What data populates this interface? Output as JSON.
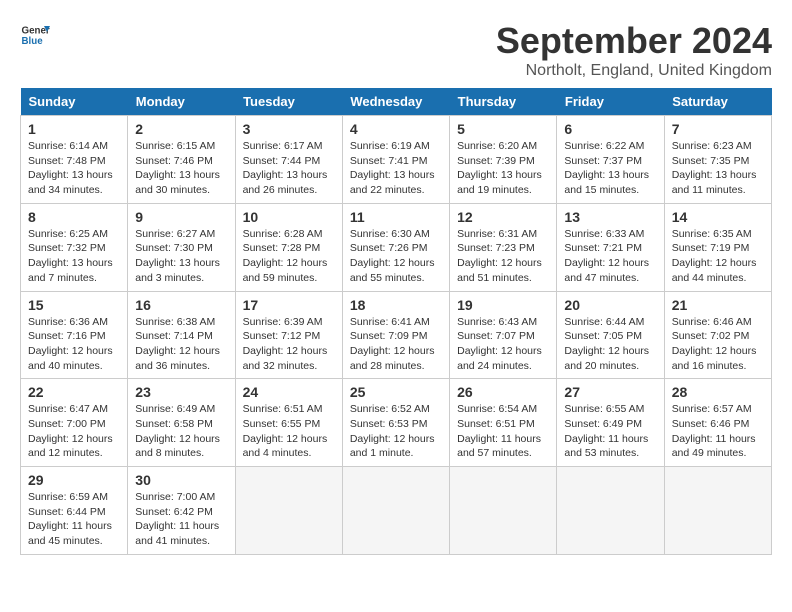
{
  "header": {
    "logo_line1": "General",
    "logo_line2": "Blue",
    "month": "September 2024",
    "location": "Northolt, England, United Kingdom"
  },
  "days_of_week": [
    "Sunday",
    "Monday",
    "Tuesday",
    "Wednesday",
    "Thursday",
    "Friday",
    "Saturday"
  ],
  "weeks": [
    [
      {
        "day": "1",
        "info": "Sunrise: 6:14 AM\nSunset: 7:48 PM\nDaylight: 13 hours\nand 34 minutes."
      },
      {
        "day": "2",
        "info": "Sunrise: 6:15 AM\nSunset: 7:46 PM\nDaylight: 13 hours\nand 30 minutes."
      },
      {
        "day": "3",
        "info": "Sunrise: 6:17 AM\nSunset: 7:44 PM\nDaylight: 13 hours\nand 26 minutes."
      },
      {
        "day": "4",
        "info": "Sunrise: 6:19 AM\nSunset: 7:41 PM\nDaylight: 13 hours\nand 22 minutes."
      },
      {
        "day": "5",
        "info": "Sunrise: 6:20 AM\nSunset: 7:39 PM\nDaylight: 13 hours\nand 19 minutes."
      },
      {
        "day": "6",
        "info": "Sunrise: 6:22 AM\nSunset: 7:37 PM\nDaylight: 13 hours\nand 15 minutes."
      },
      {
        "day": "7",
        "info": "Sunrise: 6:23 AM\nSunset: 7:35 PM\nDaylight: 13 hours\nand 11 minutes."
      }
    ],
    [
      {
        "day": "8",
        "info": "Sunrise: 6:25 AM\nSunset: 7:32 PM\nDaylight: 13 hours\nand 7 minutes."
      },
      {
        "day": "9",
        "info": "Sunrise: 6:27 AM\nSunset: 7:30 PM\nDaylight: 13 hours\nand 3 minutes."
      },
      {
        "day": "10",
        "info": "Sunrise: 6:28 AM\nSunset: 7:28 PM\nDaylight: 12 hours\nand 59 minutes."
      },
      {
        "day": "11",
        "info": "Sunrise: 6:30 AM\nSunset: 7:26 PM\nDaylight: 12 hours\nand 55 minutes."
      },
      {
        "day": "12",
        "info": "Sunrise: 6:31 AM\nSunset: 7:23 PM\nDaylight: 12 hours\nand 51 minutes."
      },
      {
        "day": "13",
        "info": "Sunrise: 6:33 AM\nSunset: 7:21 PM\nDaylight: 12 hours\nand 47 minutes."
      },
      {
        "day": "14",
        "info": "Sunrise: 6:35 AM\nSunset: 7:19 PM\nDaylight: 12 hours\nand 44 minutes."
      }
    ],
    [
      {
        "day": "15",
        "info": "Sunrise: 6:36 AM\nSunset: 7:16 PM\nDaylight: 12 hours\nand 40 minutes."
      },
      {
        "day": "16",
        "info": "Sunrise: 6:38 AM\nSunset: 7:14 PM\nDaylight: 12 hours\nand 36 minutes."
      },
      {
        "day": "17",
        "info": "Sunrise: 6:39 AM\nSunset: 7:12 PM\nDaylight: 12 hours\nand 32 minutes."
      },
      {
        "day": "18",
        "info": "Sunrise: 6:41 AM\nSunset: 7:09 PM\nDaylight: 12 hours\nand 28 minutes."
      },
      {
        "day": "19",
        "info": "Sunrise: 6:43 AM\nSunset: 7:07 PM\nDaylight: 12 hours\nand 24 minutes."
      },
      {
        "day": "20",
        "info": "Sunrise: 6:44 AM\nSunset: 7:05 PM\nDaylight: 12 hours\nand 20 minutes."
      },
      {
        "day": "21",
        "info": "Sunrise: 6:46 AM\nSunset: 7:02 PM\nDaylight: 12 hours\nand 16 minutes."
      }
    ],
    [
      {
        "day": "22",
        "info": "Sunrise: 6:47 AM\nSunset: 7:00 PM\nDaylight: 12 hours\nand 12 minutes."
      },
      {
        "day": "23",
        "info": "Sunrise: 6:49 AM\nSunset: 6:58 PM\nDaylight: 12 hours\nand 8 minutes."
      },
      {
        "day": "24",
        "info": "Sunrise: 6:51 AM\nSunset: 6:55 PM\nDaylight: 12 hours\nand 4 minutes."
      },
      {
        "day": "25",
        "info": "Sunrise: 6:52 AM\nSunset: 6:53 PM\nDaylight: 12 hours\nand 1 minute."
      },
      {
        "day": "26",
        "info": "Sunrise: 6:54 AM\nSunset: 6:51 PM\nDaylight: 11 hours\nand 57 minutes."
      },
      {
        "day": "27",
        "info": "Sunrise: 6:55 AM\nSunset: 6:49 PM\nDaylight: 11 hours\nand 53 minutes."
      },
      {
        "day": "28",
        "info": "Sunrise: 6:57 AM\nSunset: 6:46 PM\nDaylight: 11 hours\nand 49 minutes."
      }
    ],
    [
      {
        "day": "29",
        "info": "Sunrise: 6:59 AM\nSunset: 6:44 PM\nDaylight: 11 hours\nand 45 minutes."
      },
      {
        "day": "30",
        "info": "Sunrise: 7:00 AM\nSunset: 6:42 PM\nDaylight: 11 hours\nand 41 minutes."
      },
      null,
      null,
      null,
      null,
      null
    ]
  ]
}
